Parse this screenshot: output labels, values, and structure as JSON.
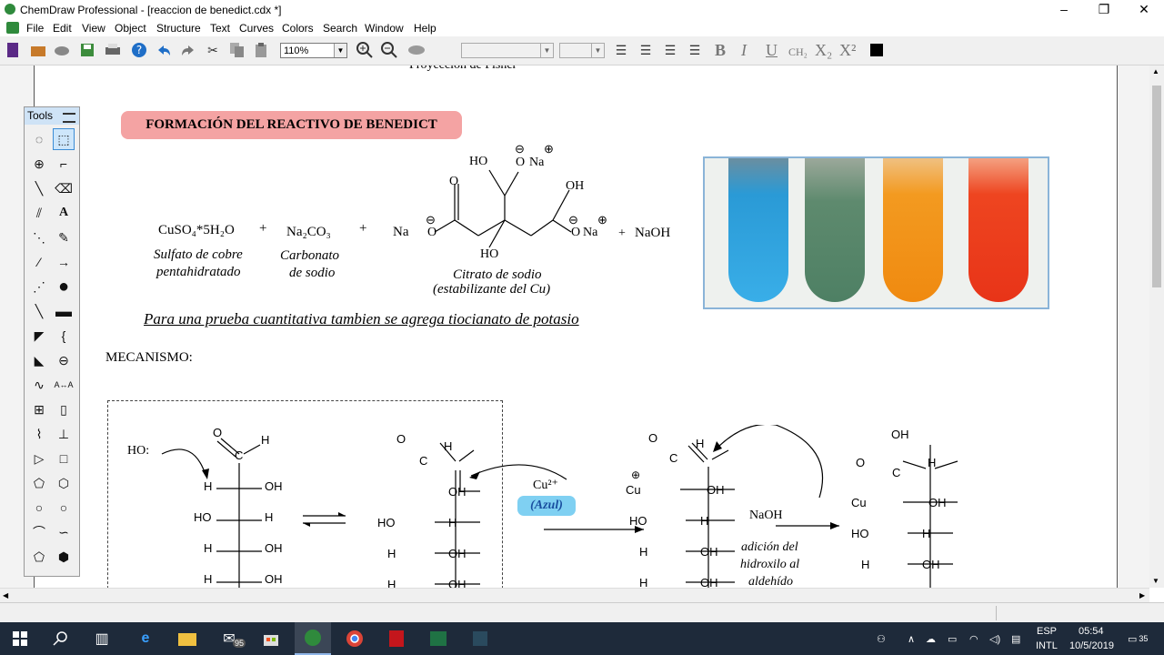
{
  "window": {
    "title": "ChemDraw Professional - [reaccion de benedict.cdx *]",
    "minimize": "–",
    "restore": "❐",
    "close": "✕"
  },
  "menu": [
    "File",
    "Edit",
    "View",
    "Object",
    "Structure",
    "Text",
    "Curves",
    "Colors",
    "Search",
    "Window",
    "Help"
  ],
  "toolbar": {
    "zoom": "110%",
    "bold": "B",
    "italic": "I",
    "underline": "U",
    "formula": "CH₂",
    "subscript": "X₂",
    "superscript": "X²"
  },
  "tools_palette": {
    "title": "Tools"
  },
  "document": {
    "top_cutoff": "Proyección de Fisher",
    "heading": "FORMACIÓN DEL REACTIVO DE BENEDICT",
    "reagents": {
      "cuso4": "CuSO₄*5H₂O",
      "plus": "+",
      "cuso4_name1": "Sulfato de cobre",
      "cuso4_name2": "pentahidratado",
      "na2co3": "Na₂CO₃",
      "na2co3_name1": "Carbonato",
      "na2co3_name2": "de sodio",
      "na": "Na",
      "naoh": "NaOH",
      "citrate_name1": "Citrato de sodio",
      "citrate_name2": "(estabilizante del Cu)",
      "ho": "HO",
      "o": "O",
      "oh": "OH",
      "minus": "⊖",
      "plus_circle": "⊕"
    },
    "note": "Para una prueba cuantitativa tambien se agrega tiocianato de potasio",
    "mechanism_label": "MECANISMO:",
    "mechanism": {
      "hydroxide": "HO:",
      "c": "C",
      "h": "H",
      "o": "O",
      "oh": "OH",
      "ho": "HO",
      "cu2": "Cu²⁺",
      "azul": "(Azul)",
      "cu": "Cu",
      "naoh": "NaOH",
      "step1": "adición del",
      "step2": "hidroxilo al",
      "step3": "aldehído",
      "ominus": "O"
    }
  },
  "taskbar": {
    "mail_badge": "95",
    "lang1": "ESP",
    "lang2": "INTL",
    "time": "05:54",
    "date": "10/5/2019",
    "notif": "35"
  }
}
